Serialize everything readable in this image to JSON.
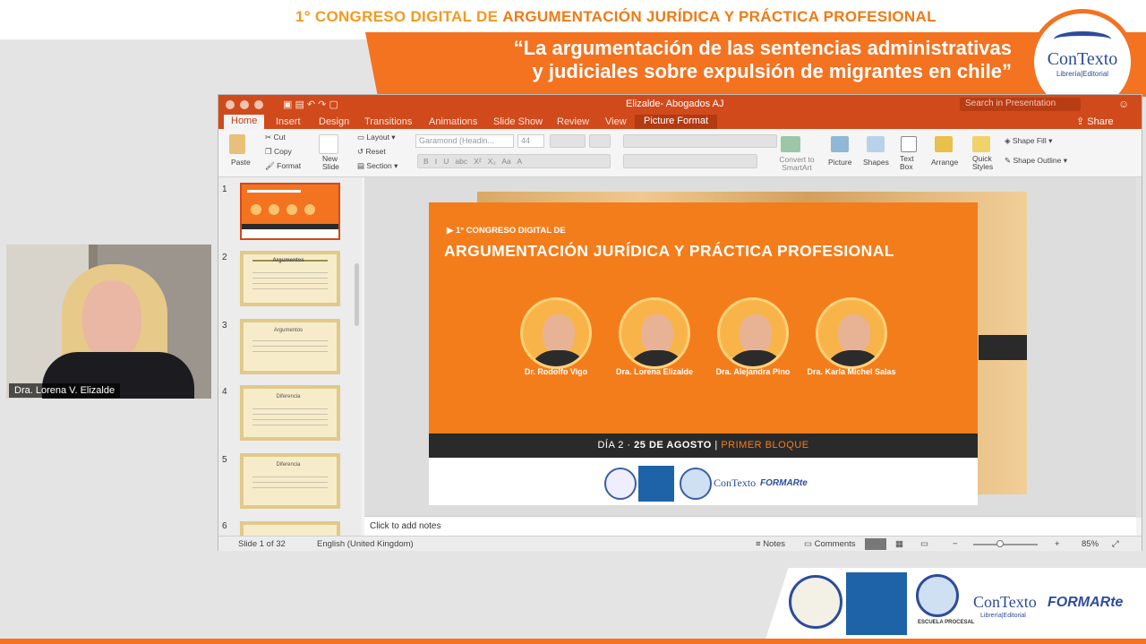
{
  "banner": {
    "congress_prefix": "1° CONGRESO DIGITAL DE ",
    "congress_highlight": "ARGUMENTACIÓN JURÍDICA Y PRÁCTICA PROFESIONAL",
    "subtitle_line1": "“La argumentación de las sentencias administrativas",
    "subtitle_line2": "y judiciales sobre expulsión de migrantes en chile”",
    "logo_name": "ConTexto",
    "logo_sub": "Librería|Editorial"
  },
  "webcam": {
    "name": "Dra. Lorena V. Elizalde"
  },
  "window": {
    "title": "Elizalde- Abogados AJ",
    "search_placeholder": "Search in Presentation",
    "share": "Share",
    "tabs": [
      "Home",
      "Insert",
      "Design",
      "Transitions",
      "Animations",
      "Slide Show",
      "Review",
      "View",
      "Picture Format"
    ]
  },
  "ribbon": {
    "paste": "Paste",
    "cut": "Cut",
    "copy": "Copy",
    "format": "Format",
    "new_slide": "New Slide",
    "layout": "Layout",
    "reset": "Reset",
    "section": "Section",
    "font": "Garamond (Headin...",
    "size": "44",
    "convert": "Convert to SmartArt",
    "picture": "Picture",
    "shapes": "Shapes",
    "text_box": "Text Box",
    "arrange": "Arrange",
    "quick_styles": "Quick Styles",
    "shape_fill": "Shape Fill",
    "shape_outline": "Shape Outline"
  },
  "thumbnails": [
    {
      "num": "1",
      "title": ""
    },
    {
      "num": "2",
      "title": "Argumentos"
    },
    {
      "num": "3",
      "title": "Argumentos"
    },
    {
      "num": "4",
      "title": "Diferencia"
    },
    {
      "num": "5",
      "title": "Diferencia"
    },
    {
      "num": "6",
      "title": ""
    }
  ],
  "slide": {
    "line1": "1° CONGRESO DIGITAL DE",
    "line2": "ARGUMENTACIÓN JURÍDICA Y PRÁCTICA PROFESIONAL",
    "speakers": [
      {
        "name": "Dr. Rodolfo Vigo"
      },
      {
        "name": "Dra. Lorena Elizalde"
      },
      {
        "name": "Dra. Alejandra Pino"
      },
      {
        "name": "Dra. Karla Michel Salas"
      }
    ],
    "day_label": "DÍA 2 · ",
    "date": "25 DE AGOSTO",
    "sep": "  |  ",
    "block": "PRIMER BLOQUE",
    "logo_contexto": "ConTexto",
    "logo_formarte": "FORMARte"
  },
  "notes": {
    "placeholder": "Click to add notes"
  },
  "status": {
    "slide": "Slide 1 of 32",
    "language": "English (United Kingdom)",
    "notes": "Notes",
    "comments": "Comments",
    "zoom": "85%",
    "minus": "−",
    "plus": "+"
  },
  "bottom_logos": {
    "contexto": "ConTexto",
    "contexto_sub": "Librería|Editorial",
    "formarte": "FORMARte",
    "escuela": "ESCUELA PROCESAL"
  },
  "colors": {
    "accent": "#f37321",
    "ppt_red": "#d04a1c",
    "dark": "#2a2a2a"
  }
}
